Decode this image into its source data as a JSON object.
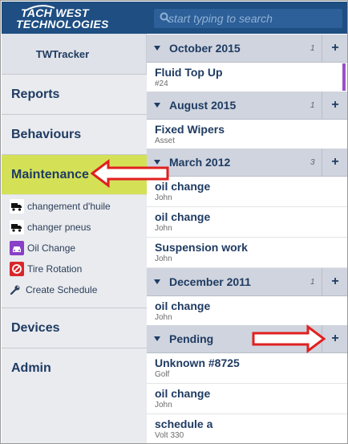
{
  "header": {
    "logo_line1": "TACH WEST",
    "logo_line2": "TECHNOLOGIES",
    "search_placeholder": "start typing to search"
  },
  "sidebar": {
    "app_title": "TWTracker",
    "nav": [
      {
        "label": "Reports"
      },
      {
        "label": "Behaviours"
      },
      {
        "label": "Maintenance",
        "active": true
      },
      {
        "label": "Devices"
      },
      {
        "label": "Admin"
      }
    ],
    "maintenance_items": [
      {
        "label": "changement d'huile",
        "icon": "truck-icon"
      },
      {
        "label": "changer pneus",
        "icon": "truck-icon"
      },
      {
        "label": "Oil Change",
        "icon": "car-icon"
      },
      {
        "label": "Tire Rotation",
        "icon": "no-entry-icon"
      },
      {
        "label": "Create Schedule",
        "icon": "wrench-icon"
      }
    ]
  },
  "groups": [
    {
      "title": "October 2015",
      "count": "1",
      "add": "+",
      "rows": [
        {
          "title": "Fluid Top Up",
          "sub": "#24",
          "accent": "#9b4fc9"
        }
      ]
    },
    {
      "title": "August 2015",
      "count": "1",
      "add": "+",
      "rows": [
        {
          "title": "Fixed Wipers",
          "sub": "Asset"
        }
      ]
    },
    {
      "title": "March 2012",
      "count": "3",
      "add": "+",
      "rows": [
        {
          "title": "oil change",
          "sub": "John"
        },
        {
          "title": "oil change",
          "sub": "John"
        },
        {
          "title": "Suspension work",
          "sub": "John"
        }
      ]
    },
    {
      "title": "December 2011",
      "count": "1",
      "add": "+",
      "rows": [
        {
          "title": "oil change",
          "sub": "John"
        }
      ]
    },
    {
      "title": "Pending",
      "count": "",
      "add": "+",
      "rows": [
        {
          "title": "Unknown #8725",
          "sub": "Golf"
        },
        {
          "title": "oil change",
          "sub": "John"
        },
        {
          "title": "schedule a",
          "sub": "Volt 330"
        }
      ]
    }
  ],
  "colors": {
    "header_bg": "#1e4e82",
    "active_nav": "#d4e157",
    "annotation_arrow": "#e02020",
    "accent_purple": "#9b4fc9"
  }
}
